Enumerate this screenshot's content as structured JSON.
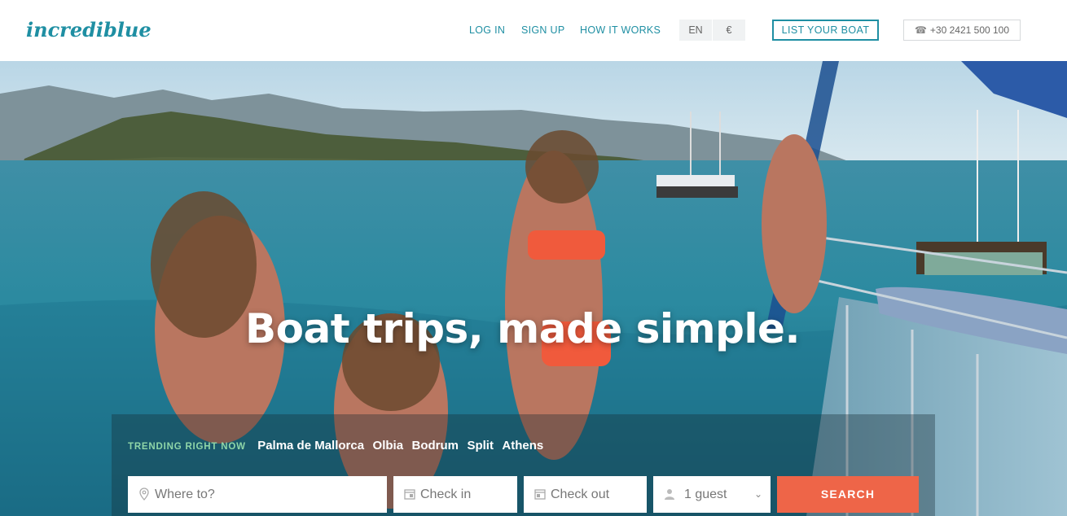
{
  "brand": {
    "logo_text": "incrediblue",
    "color": "#1f8fa3"
  },
  "nav": {
    "login": "LOG IN",
    "signup": "SIGN UP",
    "how_it_works": "HOW IT WORKS",
    "language": "EN",
    "currency": "€",
    "list_boat": "LIST YOUR BOAT",
    "phone": "+30 2421 500 100",
    "phone_icon": "phone-icon"
  },
  "hero": {
    "headline": "Boat trips, made simple.",
    "trending_label": "TRENDING RIGHT NOW",
    "trending": [
      "Palma de Mallorca",
      "Olbia",
      "Bodrum",
      "Split",
      "Athens"
    ]
  },
  "search": {
    "where_placeholder": "Where to?",
    "checkin": "Check in",
    "checkout": "Check out",
    "guests": "1 guest",
    "button": "SEARCH",
    "button_color": "#ee6548"
  }
}
